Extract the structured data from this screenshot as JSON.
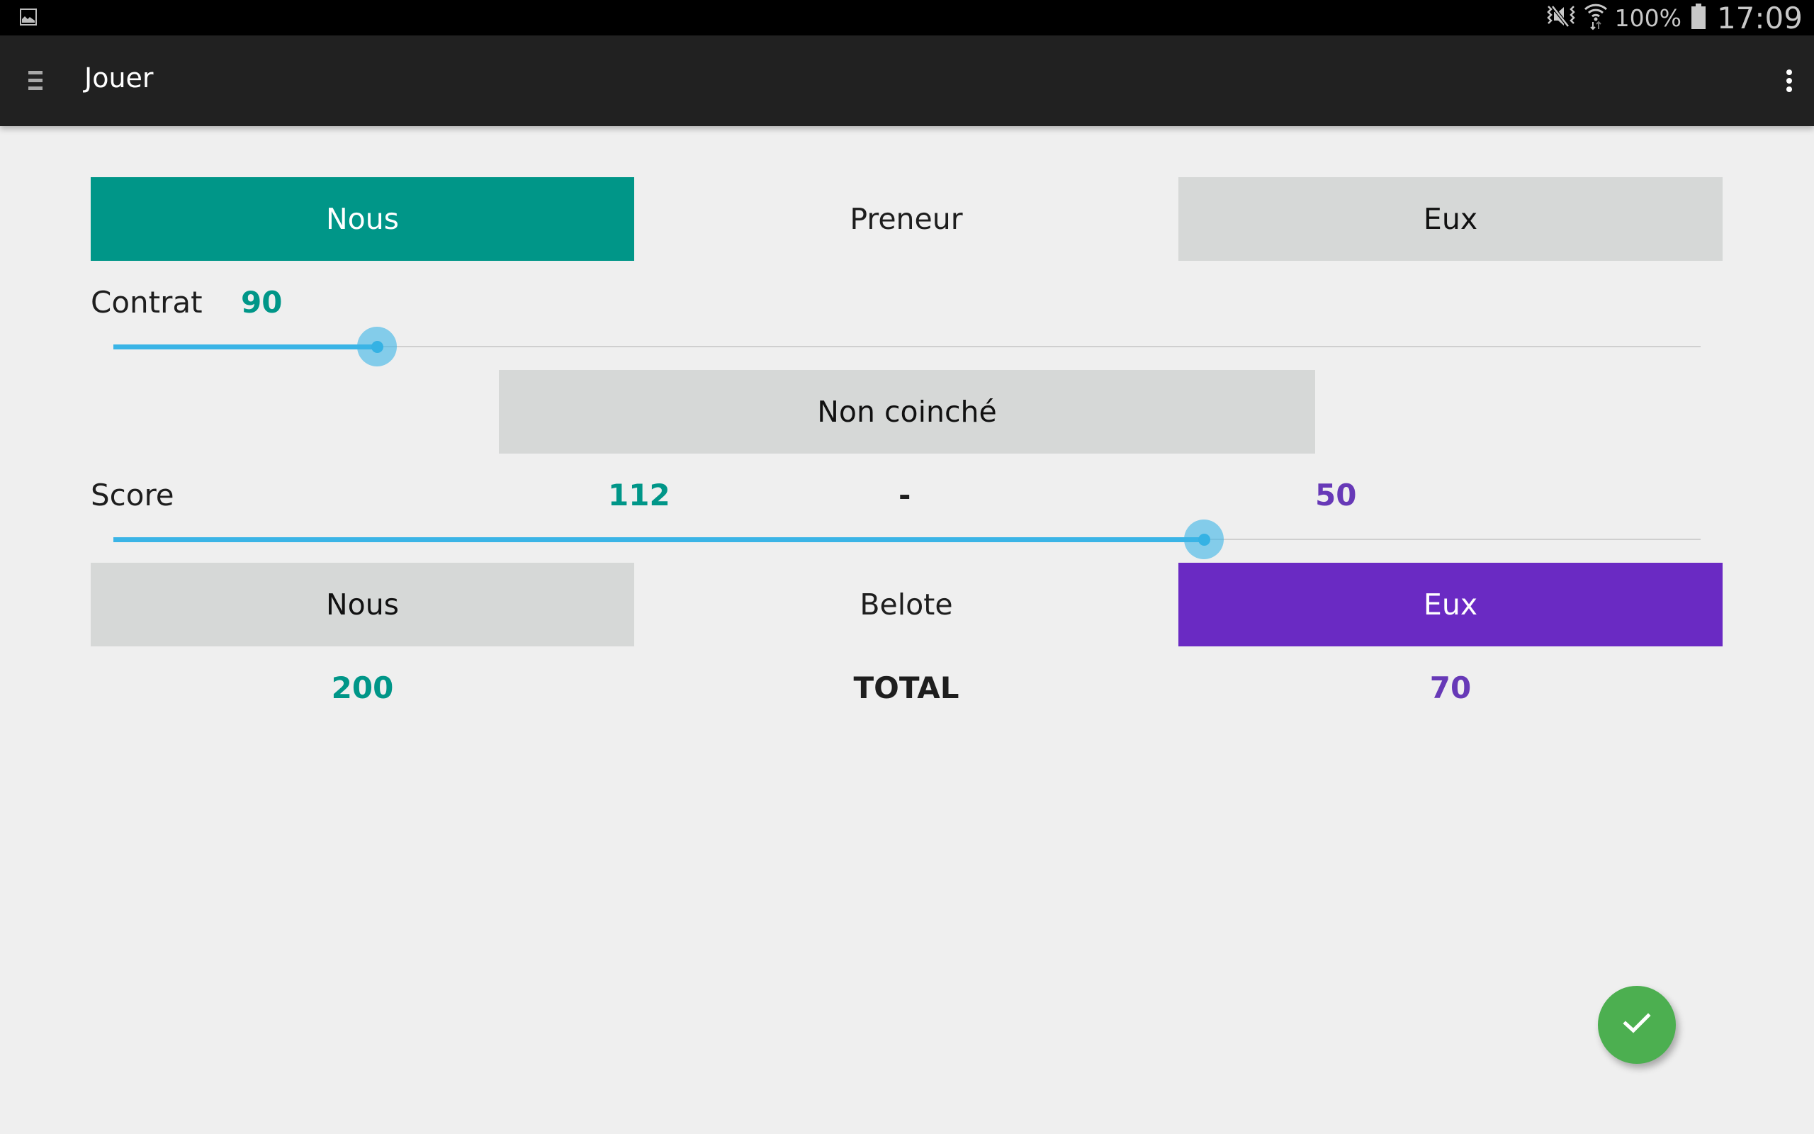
{
  "status_bar": {
    "battery_percent": "100%",
    "time": "17:09",
    "icons": [
      "gallery-notification-icon",
      "mute-vibrate-icon",
      "wifi-icon",
      "battery-icon"
    ]
  },
  "toolbar": {
    "title": "Jouer",
    "menu_icon": "hamburger-menu-icon",
    "overflow_icon": "more-vert-icon"
  },
  "preneur_row": {
    "nous_label": "Nous",
    "center_label": "Preneur",
    "eux_label": "Eux",
    "selected": "Nous"
  },
  "contrat": {
    "label": "Contrat",
    "value": "90",
    "slider_fraction": 0.166
  },
  "coinche": {
    "label": "Non coinché"
  },
  "score": {
    "label": "Score",
    "nous_value": "112",
    "separator": "-",
    "eux_value": "50",
    "slider_fraction": 0.687
  },
  "belote_row": {
    "nous_label": "Nous",
    "center_label": "Belote",
    "eux_label": "Eux",
    "selected": "Eux"
  },
  "totals": {
    "nous_total": "200",
    "label": "TOTAL",
    "eux_total": "70"
  },
  "fab": {
    "icon": "check-icon"
  },
  "colors": {
    "nous_accent": "#009688",
    "eux_accent": "#6a2ac3",
    "slider": "#3ab4e6",
    "fab": "#4caf50",
    "toolbar": "#212121"
  }
}
